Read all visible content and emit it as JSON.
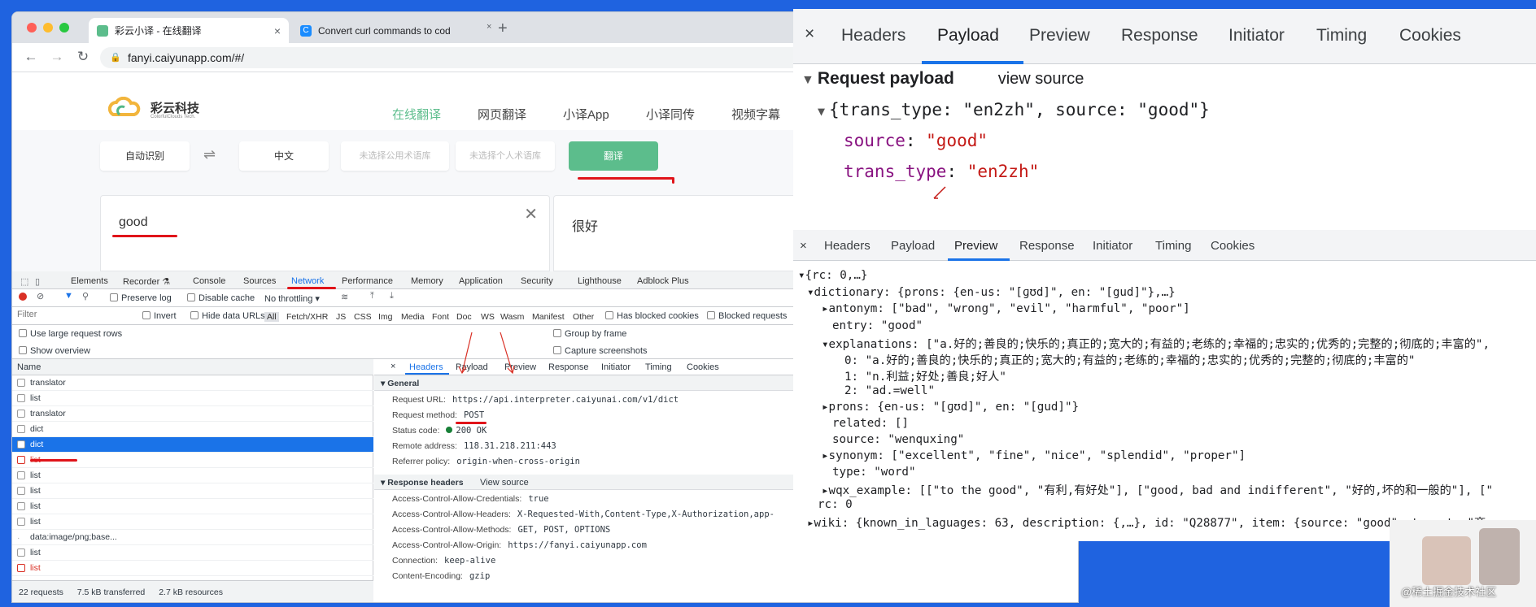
{
  "browser": {
    "tabs": [
      {
        "title": "彩云小译 - 在线翻译",
        "close": "×"
      },
      {
        "title": "Convert curl commands to cod",
        "close": "×"
      }
    ],
    "new_tab": "+",
    "url": "fanyi.caiyunapp.com/#/"
  },
  "site": {
    "logo_text": "彩云科技",
    "logo_sub": "ColorfulClouds Tech.",
    "nav": [
      "在线翻译",
      "网页翻译",
      "小译App",
      "小译同传",
      "视频字幕"
    ],
    "source_lang": "自动识别",
    "swap": "⇌",
    "target_lang": "中文",
    "corpus_public": "未选择公用术语库",
    "corpus_private": "未选择个人术语库",
    "translate_btn": "翻译",
    "input_text": "good",
    "clear": "✕",
    "output_text": "很好"
  },
  "devtools": {
    "tabs": [
      "Elements",
      "Recorder ⚗",
      "Console",
      "Sources",
      "Network",
      "Performance",
      "Memory",
      "Application",
      "Security",
      "Lighthouse",
      "Adblock Plus"
    ],
    "toolbar": {
      "preserve_log": "Preserve log",
      "disable_cache": "Disable cache",
      "throttling": "No throttling"
    },
    "filter_placeholder": "Filter",
    "invert": "Invert",
    "hide_data_urls": "Hide data URLs",
    "types": [
      "All",
      "Fetch/XHR",
      "JS",
      "CSS",
      "Img",
      "Media",
      "Font",
      "Doc",
      "WS",
      "Wasm",
      "Manifest",
      "Other"
    ],
    "has_blocked_cookies": "Has blocked cookies",
    "blocked_requests": "Blocked requests",
    "opt_large_rows": "Use large request rows",
    "opt_overview": "Show overview",
    "opt_group": "Group by frame",
    "opt_screenshots": "Capture screenshots",
    "name_col": "Name",
    "requests": [
      "translator",
      "list",
      "translator",
      "dict",
      "dict",
      "list",
      "list",
      "list",
      "list",
      "list",
      "data:image/png;base...",
      "list",
      "list"
    ],
    "status_bar": {
      "requests": "22 requests",
      "transferred": "7.5 kB transferred",
      "resources": "2.7 kB resources"
    },
    "detail_tabs": [
      "×",
      "Headers",
      "Payload",
      "Preview",
      "Response",
      "Initiator",
      "Timing",
      "Cookies"
    ],
    "general_title": "▾ General",
    "general": [
      {
        "k": "Request URL:",
        "v": "https://api.interpreter.caiyunai.com/v1/dict"
      },
      {
        "k": "Request method:",
        "v": "POST"
      },
      {
        "k": "Status code:",
        "v": "200 OK"
      },
      {
        "k": "Remote address:",
        "v": "118.31.218.211:443"
      },
      {
        "k": "Referrer policy:",
        "v": "origin-when-cross-origin"
      }
    ],
    "response_headers_title": "▾ Response headers",
    "view_source": "View source",
    "response_headers": [
      {
        "k": "Access-Control-Allow-Credentials:",
        "v": "true"
      },
      {
        "k": "Access-Control-Allow-Headers:",
        "v": "X-Requested-With,Content-Type,X-Authorization,app-"
      },
      {
        "k": "Access-Control-Allow-Methods:",
        "v": "GET, POST, OPTIONS"
      },
      {
        "k": "Access-Control-Allow-Origin:",
        "v": "https://fanyi.caiyunapp.com"
      },
      {
        "k": "Connection:",
        "v": "keep-alive"
      },
      {
        "k": "Content-Encoding:",
        "v": "gzip"
      }
    ]
  },
  "popup": {
    "close": "×",
    "tabs": [
      "Headers",
      "Payload",
      "Preview",
      "Response",
      "Initiator",
      "Timing",
      "Cookies"
    ],
    "payload_title": "Request payload",
    "view_source": "view source",
    "payload_summary": "{trans_type: \"en2zh\", source: \"good\"}",
    "payload_fields": [
      {
        "k": "source",
        "v": "\"good\""
      },
      {
        "k": "trans_type",
        "v": "\"en2zh\""
      }
    ],
    "sub_tabs": [
      "×",
      "Headers",
      "Payload",
      "Preview",
      "Response",
      "Initiator",
      "Timing",
      "Cookies"
    ],
    "json_lines": [
      "▾{rc: 0,…}",
      "▾dictionary: {prons: {en-us: \"[ɡʊd]\", en: \"[gud]\"},…}",
      "▸antonym: [\"bad\", \"wrong\", \"evil\", \"harmful\", \"poor\"]",
      "entry: \"good\"",
      "▾explanations: [\"a.好的;善良的;快乐的;真正的;宽大的;有益的;老练的;幸福的;忠实的;优秀的;完整的;彻底的;丰富的\",",
      "0: \"a.好的;善良的;快乐的;真正的;宽大的;有益的;老练的;幸福的;忠实的;优秀的;完整的;彻底的;丰富的\"",
      "1: \"n.利益;好处;善良;好人\"",
      "2: \"ad.=well\"",
      "▸prons: {en-us: \"[ɡʊd]\", en: \"[gud]\"}",
      "related: []",
      "source: \"wenquxing\"",
      "▸synonym: [\"excellent\", \"fine\", \"nice\", \"splendid\", \"proper\"]",
      "type: \"word\"",
      "▸wqx_example: [[\"to the good\", \"有利,有好处\"], [\"good, bad and indifferent\", \"好的,坏的和一般的\"], [\"",
      "rc: 0",
      "▸wiki: {known_in_laguages: 63, description: {,…}, id: \"Q28877\", item: {source: \"good\", target: \"商"
    ]
  },
  "watermark": "@稀土掘金技术社区"
}
